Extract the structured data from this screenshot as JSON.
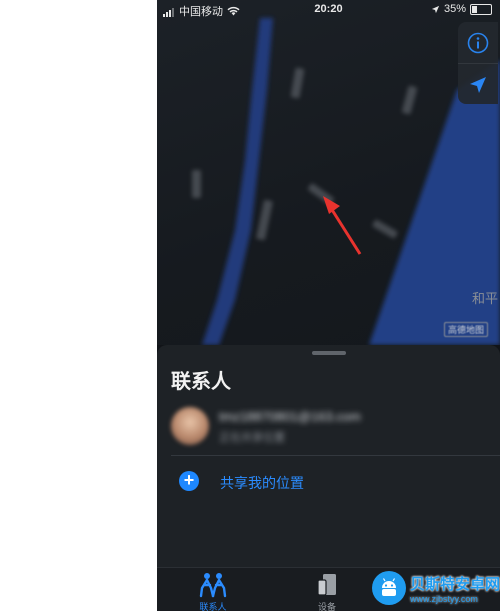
{
  "status_bar": {
    "carrier": "中国移动",
    "time": "20:20",
    "battery": "35%",
    "battery_level": 0.35,
    "icons": [
      "signal-icon",
      "wifi-icon",
      "location-arrow-icon",
      "battery-icon"
    ]
  },
  "map": {
    "label": "和平",
    "badge": "高德地图",
    "controls": [
      "info-icon",
      "location-icon"
    ]
  },
  "sheet": {
    "title": "联系人",
    "contact": {
      "email": "tmz18870801@163.com",
      "subtitle": "正在共享位置"
    },
    "share_action": "共享我的位置"
  },
  "tab_bar": {
    "tabs": [
      {
        "label": "联系人",
        "icon": "people-icon",
        "active": true
      },
      {
        "label": "设备",
        "icon": "devices-icon",
        "active": false
      }
    ]
  },
  "watermark": {
    "title": "贝斯特安卓网",
    "url": "www.zjbstyy.com"
  },
  "colors": {
    "accent": "#2b8cff",
    "map_bg": "#161a1f",
    "river": "#243f86",
    "sheet_bg": "#1e2226",
    "annotation_arrow": "#e8332e"
  }
}
